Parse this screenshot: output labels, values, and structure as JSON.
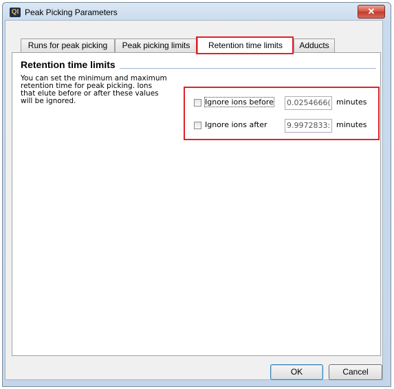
{
  "window": {
    "title": "Peak Picking Parameters",
    "app_icon_text": "QI",
    "close_symbol": "✕"
  },
  "tabs": [
    {
      "label": "Runs for peak picking",
      "active": false
    },
    {
      "label": "Peak picking limits",
      "active": false
    },
    {
      "label": "Retention time limits",
      "active": true
    },
    {
      "label": "Adducts",
      "active": false
    }
  ],
  "section": {
    "title": "Retention time limits",
    "description": "You can set the minimum and maximum retention time for peak picking. Ions that elute before or after these values will be ignored."
  },
  "fields": {
    "before": {
      "label": "Ignore ions before",
      "checked": false,
      "value": "0.0254666(",
      "unit": "minutes"
    },
    "after": {
      "label": "Ignore ions after",
      "checked": false,
      "value": "9.9972833:",
      "unit": "minutes"
    }
  },
  "buttons": {
    "ok": "OK",
    "cancel": "Cancel"
  },
  "colors": {
    "highlight": "#e0202a",
    "accent": "#3c7fb1"
  }
}
